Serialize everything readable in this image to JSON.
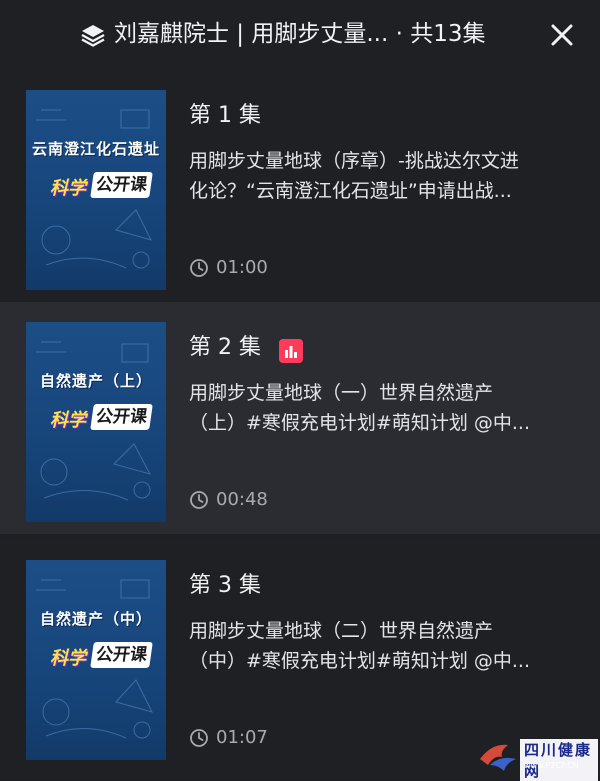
{
  "header": {
    "icon": "layers-icon",
    "title": "刘嘉麒院士 | 用脚步丈量... · 共13集",
    "close_icon": "close-icon"
  },
  "episodes": [
    {
      "title": "第 1 集",
      "thumb_caption": "云南澄江化石遗址",
      "thumb_badge": "科学公开课",
      "thumb_badge_a": "科学",
      "thumb_badge_b": "公开课",
      "desc_line1": "用脚步丈量地球（序章）-挑战达尔文进",
      "desc_line2": "化论？“云南澄江化石遗址”申请出战...",
      "duration": "01:00",
      "playing": false
    },
    {
      "title": "第 2 集",
      "thumb_caption": "自然遗产（上）",
      "thumb_badge": "科学公开课",
      "thumb_badge_a": "科学",
      "thumb_badge_b": "公开课",
      "desc_line1": "用脚步丈量地球（一）世界自然遗产",
      "desc_line2": "（上）#寒假充电计划#萌知计划 @中...",
      "duration": "00:48",
      "playing": true,
      "playing_icon": "equalizer-icon",
      "playing_color": "#ff3b5c"
    },
    {
      "title": "第 3 集",
      "thumb_caption": "自然遗产（中）",
      "thumb_badge": "科学公开课",
      "thumb_badge_a": "科学",
      "thumb_badge_b": "公开课",
      "desc_line1": "用脚步丈量地球（二）世界自然遗产",
      "desc_line2": "（中）#寒假充电计划#萌知计划 @中...",
      "duration": "01:07",
      "playing": false
    }
  ],
  "watermark": {
    "text": "四川健康网",
    "url": "www.P2CP.CN",
    "logo": "bird-logo"
  }
}
